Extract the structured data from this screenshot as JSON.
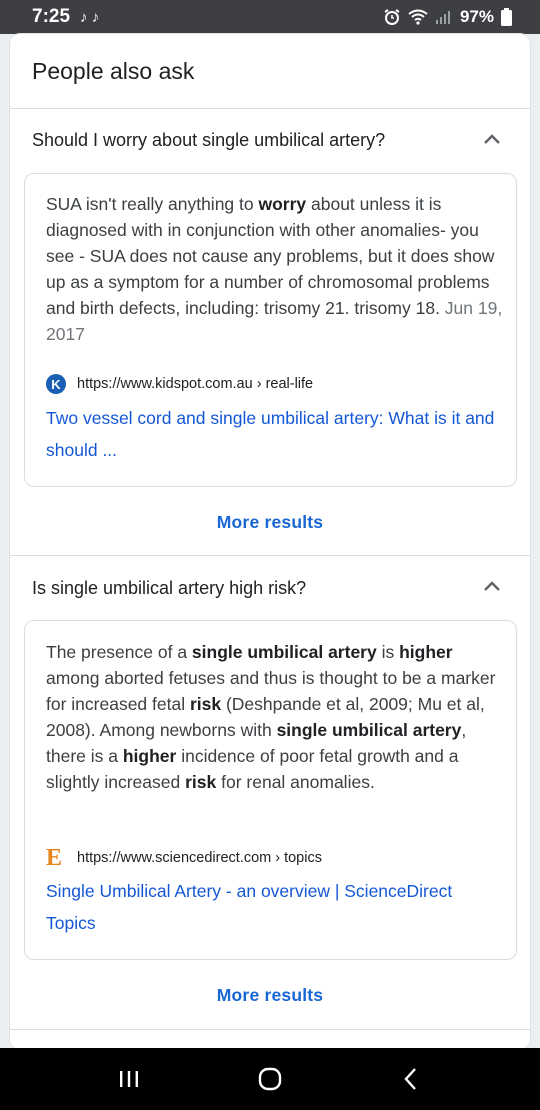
{
  "status_bar": {
    "time": "7:25",
    "tiktok_icons": "♪ ♪",
    "battery": "97%",
    "icons": [
      "alarm-icon",
      "wifi-icon",
      "signal-icon",
      "battery-icon"
    ]
  },
  "card": {
    "title": "People also ask",
    "items": [
      {
        "question": "Should I worry about single umbilical artery?",
        "answer_html": "SUA isn't really anything to <b>worry</b> about unless it is diagnosed with in conjunction with other anomalies- you see - SUA does not cause any problems, but it does show up as a symptom for a number of chromosomal problems and birth defects, including: trisomy 21. trisomy 18.",
        "date": "Jun 19, 2017",
        "source_url": "https://www.kidspot.com.au › real-life",
        "source_title": "Two vessel cord and single umbilical artery: What is it and should ...",
        "favicon": "K"
      },
      {
        "question": "Is single umbilical artery high risk?",
        "answer_html": "The presence of a <b>single umbilical artery</b> is <b>higher</b> among aborted fetuses and thus is thought to be a marker for increased fetal <b>risk</b> (Deshpande et al, 2009; Mu et al, 2008). Among newborns with <b>single umbilical artery</b>, there is a <b>higher</b> incidence of poor fetal growth and a slightly increased <b>risk</b> for renal anomalies.",
        "date": "",
        "source_url": "https://www.sciencedirect.com › topics",
        "source_title": "Single Umbilical Artery - an overview | ScienceDirect Topics",
        "favicon": "E"
      }
    ],
    "more_results": "More results"
  },
  "colors": {
    "link": "#1558d6",
    "more_results": "#1967d2",
    "status_bar_bg": "#3d3f42",
    "nav_bar_bg": "#000000"
  },
  "nav_bar": {
    "icons": [
      "recents-icon",
      "home-icon",
      "back-icon"
    ]
  }
}
